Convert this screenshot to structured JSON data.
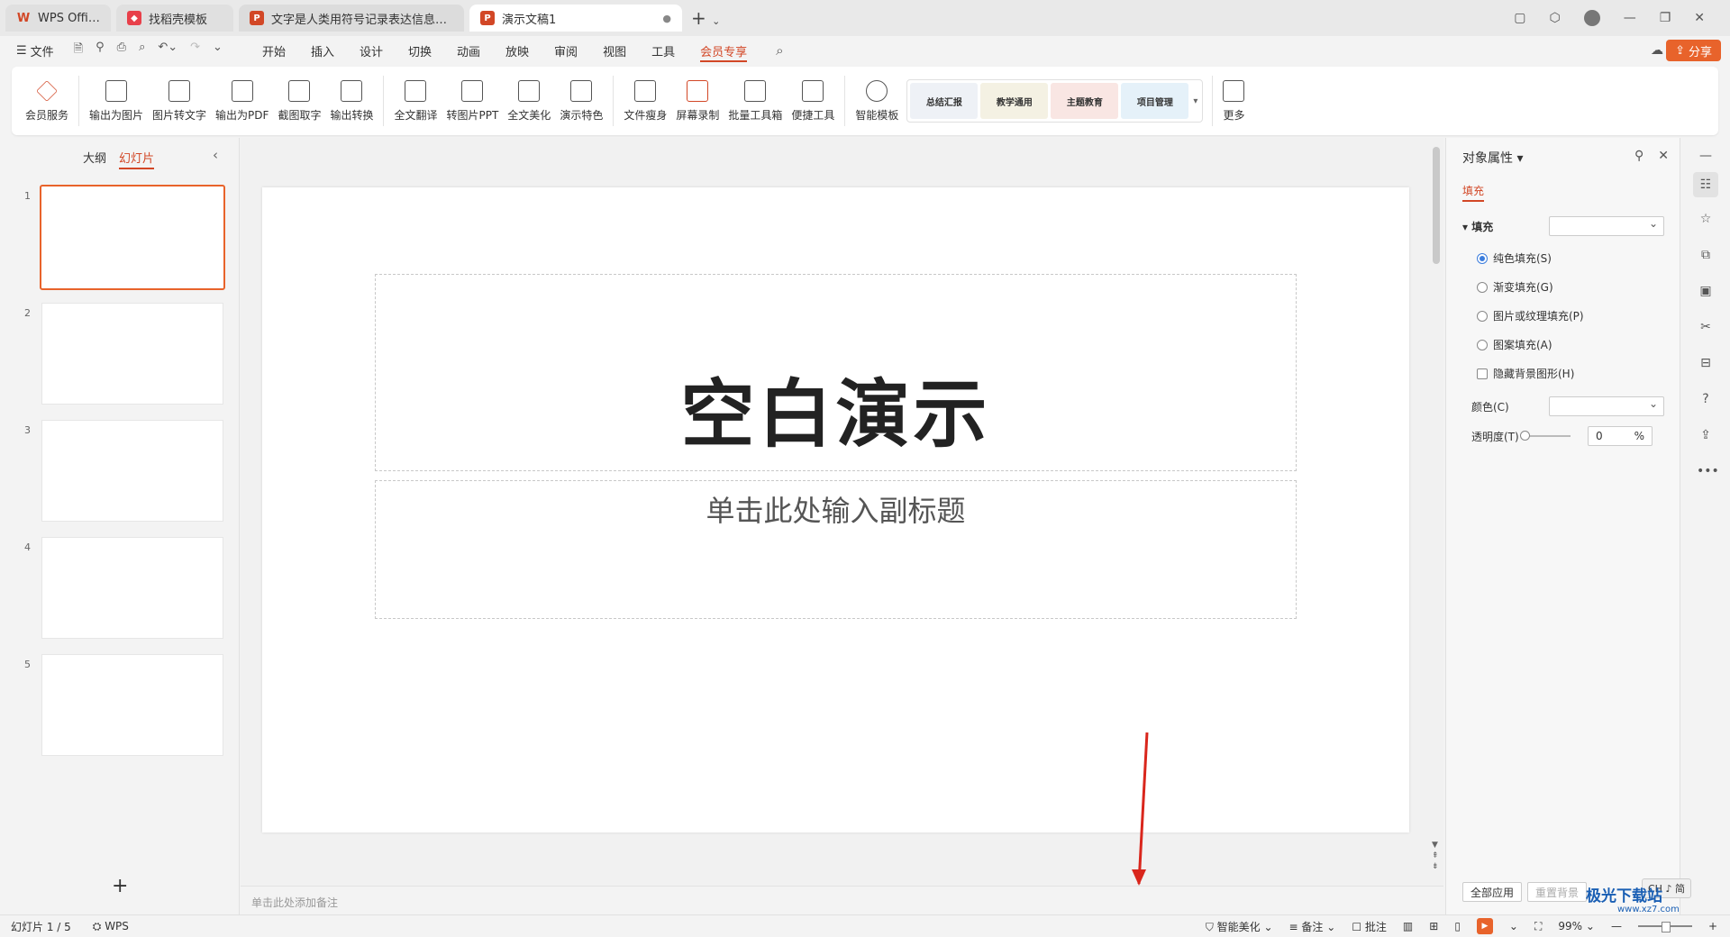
{
  "tabs": [
    {
      "label": "WPS Office",
      "logo": "W",
      "color": "#d24726"
    },
    {
      "label": "找稻壳模板",
      "logo": "d",
      "color": "#e8404a"
    },
    {
      "label": "文字是人类用符号记录表达信息以传之",
      "logo": "P",
      "color": "#d24726"
    },
    {
      "label": "演示文稿1",
      "logo": "P",
      "color": "#d24726"
    }
  ],
  "menu": {
    "file": "文件",
    "tabs": [
      "开始",
      "插入",
      "设计",
      "切换",
      "动画",
      "放映",
      "审阅",
      "视图",
      "工具",
      "会员专享"
    ],
    "share": "分享"
  },
  "ribbon": {
    "group1": [
      "会员服务"
    ],
    "group2": [
      "输出为图片",
      "图片转文字",
      "输出为PDF",
      "截图取字",
      "输出转换"
    ],
    "group3": [
      "全文翻译",
      "转图片PPT",
      "全文美化",
      "演示特色"
    ],
    "group4": [
      "文件瘦身",
      "屏幕录制",
      "批量工具箱",
      "便捷工具"
    ],
    "group5": [
      "智能模板"
    ],
    "templates": [
      "总结汇报",
      "教学通用",
      "主题教育",
      "项目管理"
    ],
    "more": "更多"
  },
  "left_panel": {
    "tab_outline": "大纲",
    "tab_slides": "幻灯片",
    "slides": [
      "1",
      "2",
      "3",
      "4",
      "5"
    ]
  },
  "slide": {
    "title": "空白演示",
    "subtitle": "单击此处输入副标题"
  },
  "notes_placeholder": "单击此处添加备注",
  "right_panel": {
    "title": "对象属性",
    "tab": "填充",
    "fill_heading": "填充",
    "options": [
      "纯色填充(S)",
      "渐变填充(G)",
      "图片或纹理填充(P)",
      "图案填充(A)"
    ],
    "checkbox": "隐藏背景图形(H)",
    "color_label": "颜色(C)",
    "opacity_label": "透明度(T)",
    "opacity_value": "0",
    "opacity_unit": "%",
    "apply_all": "全部应用",
    "reset_bg": "重置背景"
  },
  "status": {
    "slide_count": "幻灯片 1 / 5",
    "wps": "WPS",
    "beautify": "智能美化",
    "notes": "备注",
    "comments": "批注",
    "zoom": "99%"
  },
  "ime": "CH ♪ 简",
  "watermark": "极光下载站",
  "watermark_sub": "www.xz7.com",
  "colors": {
    "accent": "#d24726",
    "annotation_arrow": "#d9261c"
  }
}
